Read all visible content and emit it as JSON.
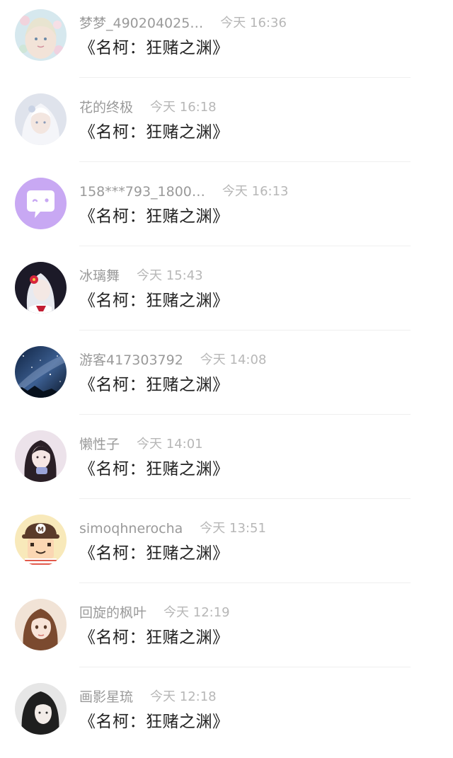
{
  "comments": [
    {
      "username": "梦梦_490204025…",
      "time": "今天 16:36",
      "message": "《名柯：狂赌之渊》",
      "avatar": "anime-girl-flowers-avatar",
      "avatar_colors": [
        "#cfe3ea",
        "#f2d7d9"
      ]
    },
    {
      "username": "花的终极",
      "time": "今天 16:18",
      "message": "《名柯：狂赌之渊》",
      "avatar": "white-haired-girl-avatar",
      "avatar_colors": [
        "#d9dfe9",
        "#f2f4f8"
      ]
    },
    {
      "username": "158***793_1800…",
      "time": "今天 16:13",
      "message": "《名柯：狂赌之渊》",
      "avatar": "default-chat-bubble-avatar",
      "avatar_colors": [
        "#c9a9f4",
        "#ffffff"
      ]
    },
    {
      "username": "冰璃舞",
      "time": "今天 15:43",
      "message": "《名柯：狂赌之渊》",
      "avatar": "red-flower-girl-avatar",
      "avatar_colors": [
        "#1d1a2a",
        "#d7263d"
      ]
    },
    {
      "username": "游客417303792",
      "time": "今天 14:08",
      "message": "《名柯：狂赌之渊》",
      "avatar": "starry-sky-avatar",
      "avatar_colors": [
        "#122a4a",
        "#6d8bb8"
      ]
    },
    {
      "username": "懒性子",
      "time": "今天 14:01",
      "message": "《名柯：狂赌之渊》",
      "avatar": "dark-haired-girl-avatar",
      "avatar_colors": [
        "#e9dde6",
        "#2a1f26"
      ]
    },
    {
      "username": "simoqhnerocha",
      "time": "今天 13:51",
      "message": "《名柯：狂赌之渊》",
      "avatar": "cartoon-boy-m-cap-avatar",
      "avatar_colors": [
        "#f7e7b6",
        "#5a3b2a"
      ]
    },
    {
      "username": "回旋的枫叶",
      "time": "今天 12:19",
      "message": "《名柯：狂赌之渊》",
      "avatar": "brown-haired-girl-avatar",
      "avatar_colors": [
        "#f3e1d3",
        "#7b4a2f"
      ]
    },
    {
      "username": "画影星琉",
      "time": "今天 12:18",
      "message": "《名柯：狂赌之渊》",
      "avatar": "black-haired-girl-avatar",
      "avatar_colors": [
        "#e9e9e9",
        "#1f1f1f"
      ]
    }
  ]
}
